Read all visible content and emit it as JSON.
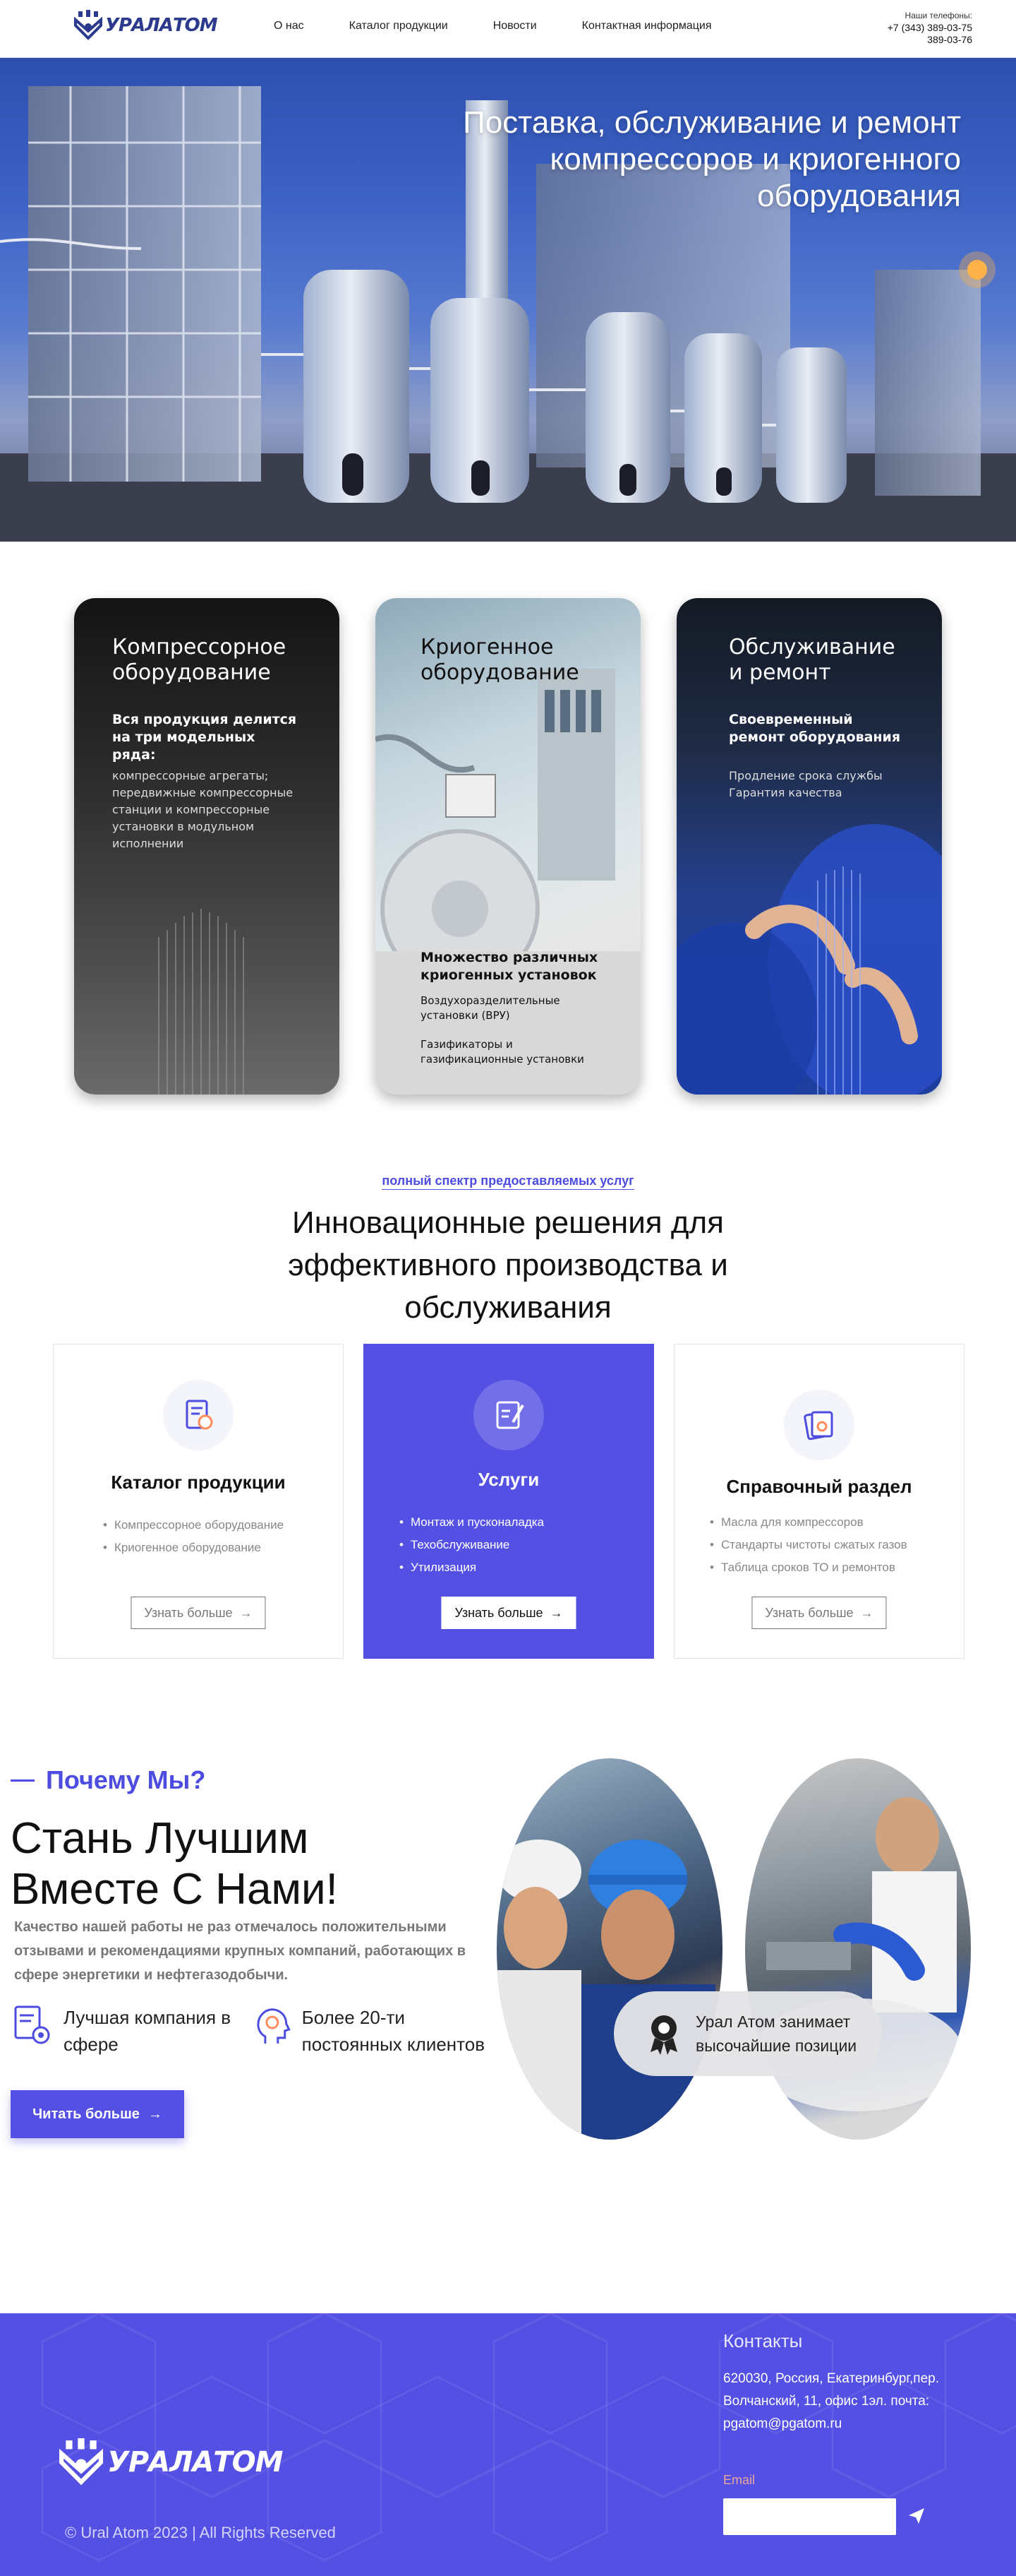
{
  "header": {
    "logo_text": "УРАЛАТОМ",
    "nav": [
      "О нас",
      "Каталог продукции",
      "Новости",
      "Контактная информация"
    ],
    "phones_label": "Наши телефоны:",
    "phone_1": "+7 (343) 389-03-75",
    "phone_2": "389-03-76"
  },
  "hero": {
    "title": "Поставка, обслуживание и ремонт компрессоров и криогенного оборудования"
  },
  "cards": [
    {
      "title": "Компрессорное оборудование",
      "subtitle": "Вся продукция делится на три модельных ряда:",
      "body": "компрессорные агрегаты; передвижные компрессорные станции и компрессорные установки в модульном исполнении"
    },
    {
      "title": "Криогенное оборудование",
      "subtitle": "Множество различных криогенных установок",
      "body_1": "Воздухоразделительные установки (ВРУ)",
      "body_2": "Газификаторы и газификационные установки"
    },
    {
      "title": "Обслуживание и ремонт",
      "subtitle": "Своевременный ремонт оборудования",
      "body_1": "Продление срока службы",
      "body_2": "Гарантия качества"
    }
  ],
  "services": {
    "tagline": "полный спектр предоставляемых услуг",
    "title": "Инновационные решения для эффективного производства и обслуживания",
    "items": [
      {
        "title": "Каталог продукции",
        "list": [
          "Компрессорное оборудование",
          "Криогенное оборудование"
        ],
        "button": "Узнать больше"
      },
      {
        "title": "Услуги",
        "list": [
          "Монтаж и пусконаладка",
          "Техобслуживание",
          "Утилизация"
        ],
        "button": "Узнать больше"
      },
      {
        "title": "Справочный раздел",
        "list": [
          "Масла для компрессоров",
          "Стандарты чистоты сжатых газов",
          "Таблица сроков ТО и ремонтов"
        ],
        "button": "Узнать больше"
      }
    ]
  },
  "why": {
    "label": "Почему Мы?",
    "title_1": "Стань Лучшим",
    "title_2": "Вместе С Нами!",
    "text": "Качество нашей работы не раз отмечалось положительными отзывами и рекомендациями крупных компаний, работающих в сфере энергетики и нефтегазодобычи.",
    "feature_1": "Лучшая компания в сфере",
    "feature_2": "Более 20-ти постоянных клиентов",
    "button": "Читать больше",
    "badge": "Урал Атом занимает высочайшие позиции"
  },
  "footer": {
    "logo_text": "УРАЛАТОМ",
    "copyright": "© Ural Atom  2023 | All Rights Reserved",
    "contacts_title": "Контакты",
    "address": "620030, Россия, Екатеринбург,пер. Волчанский, 11, офис 1эл. почта: pgatom@pgatom.ru",
    "email_label": "Email",
    "email_placeholder": ""
  },
  "colors": {
    "accent": "#5450e4",
    "logo": "#2b3a8c"
  }
}
